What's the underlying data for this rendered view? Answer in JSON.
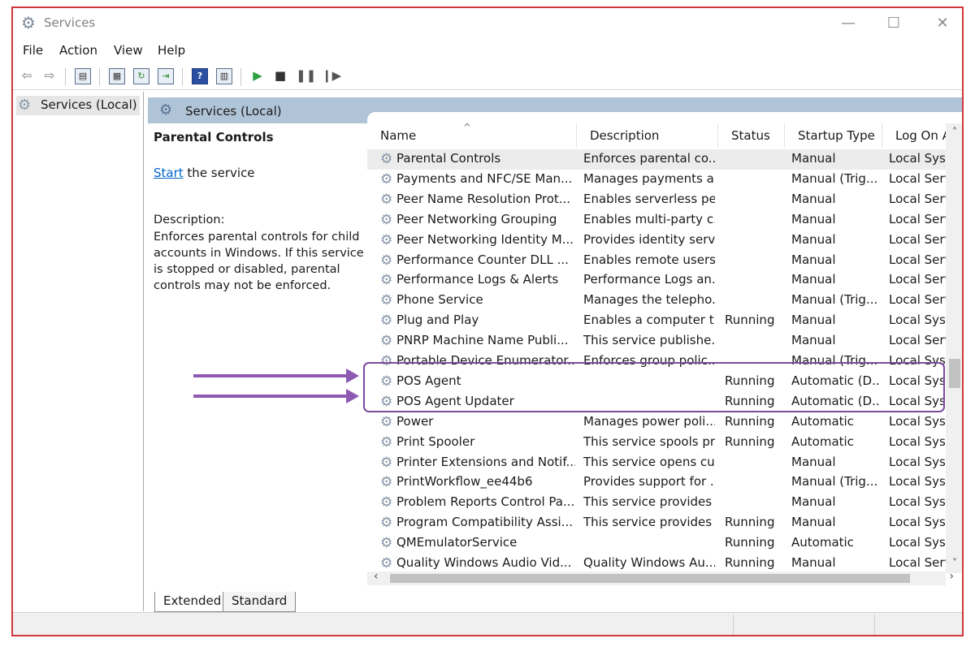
{
  "window": {
    "title": "Services",
    "icon": "gear-icon",
    "controls": [
      "—",
      "☐",
      "✕"
    ]
  },
  "menu": [
    "File",
    "Action",
    "View",
    "Help"
  ],
  "toolbar": {
    "icons": [
      "back-arrow-icon",
      "forward-arrow-icon",
      "show-console-tree-icon",
      "properties-icon",
      "refresh-icon",
      "export-list-icon",
      "help-icon",
      "show-hide-action-pane-icon",
      "start-service-icon",
      "stop-service-icon",
      "pause-service-icon",
      "resume-service-icon"
    ]
  },
  "tree": {
    "item": "Services (Local)"
  },
  "pane": {
    "title": "Services (Local)"
  },
  "description_panel": {
    "title": "Parental Controls",
    "start_link": "Start",
    "start_suffix": " the service",
    "label": "Description:",
    "body": "Enforces parental controls for child accounts in Windows. If this service is stopped or disabled, parental controls may not be enforced."
  },
  "columns": [
    "Name",
    "Description",
    "Status",
    "Startup Type",
    "Log On As"
  ],
  "rows": [
    {
      "name": "Parental Controls",
      "desc": "Enforces parental co...",
      "status": "",
      "startup": "Manual",
      "logon": "Local Syste...",
      "selected": true
    },
    {
      "name": "Payments and NFC/SE Man...",
      "desc": "Manages payments a...",
      "status": "",
      "startup": "Manual (Trig...",
      "logon": "Local Service"
    },
    {
      "name": "Peer Name Resolution Prot...",
      "desc": "Enables serverless pe...",
      "status": "",
      "startup": "Manual",
      "logon": "Local Service"
    },
    {
      "name": "Peer Networking Grouping",
      "desc": "Enables multi-party c...",
      "status": "",
      "startup": "Manual",
      "logon": "Local Service"
    },
    {
      "name": "Peer Networking Identity M...",
      "desc": "Provides identity serv...",
      "status": "",
      "startup": "Manual",
      "logon": "Local Service"
    },
    {
      "name": "Performance Counter DLL ...",
      "desc": "Enables remote users...",
      "status": "",
      "startup": "Manual",
      "logon": "Local Service"
    },
    {
      "name": "Performance Logs & Alerts",
      "desc": "Performance Logs an...",
      "status": "",
      "startup": "Manual",
      "logon": "Local Service"
    },
    {
      "name": "Phone Service",
      "desc": "Manages the telepho...",
      "status": "",
      "startup": "Manual (Trig...",
      "logon": "Local Service"
    },
    {
      "name": "Plug and Play",
      "desc": "Enables a computer t...",
      "status": "Running",
      "startup": "Manual",
      "logon": "Local Syste..."
    },
    {
      "name": "PNRP Machine Name Publi...",
      "desc": "This service publishe...",
      "status": "",
      "startup": "Manual",
      "logon": "Local Service"
    },
    {
      "name": "Portable Device Enumerator...",
      "desc": "Enforces group polic...",
      "status": "",
      "startup": "Manual (Trig...",
      "logon": "Local Syste..."
    },
    {
      "name": "POS Agent",
      "desc": "",
      "status": "Running",
      "startup": "Automatic (D...",
      "logon": "Local Syste..."
    },
    {
      "name": "POS Agent Updater",
      "desc": "",
      "status": "Running",
      "startup": "Automatic (D...",
      "logon": "Local Syste..."
    },
    {
      "name": "Power",
      "desc": "Manages power poli...",
      "status": "Running",
      "startup": "Automatic",
      "logon": "Local Syste..."
    },
    {
      "name": "Print Spooler",
      "desc": "This service spools pr...",
      "status": "Running",
      "startup": "Automatic",
      "logon": "Local Syste..."
    },
    {
      "name": "Printer Extensions and Notif...",
      "desc": "This service opens cu...",
      "status": "",
      "startup": "Manual",
      "logon": "Local Syste..."
    },
    {
      "name": "PrintWorkflow_ee44b6",
      "desc": "Provides support for ...",
      "status": "",
      "startup": "Manual (Trig...",
      "logon": "Local Syste..."
    },
    {
      "name": "Problem Reports Control Pa...",
      "desc": "This service provides ...",
      "status": "",
      "startup": "Manual",
      "logon": "Local Syste..."
    },
    {
      "name": "Program Compatibility Assi...",
      "desc": "This service provides ...",
      "status": "Running",
      "startup": "Manual",
      "logon": "Local Syste..."
    },
    {
      "name": "QMEmulatorService",
      "desc": "",
      "status": "Running",
      "startup": "Automatic",
      "logon": "Local Syste..."
    },
    {
      "name": "Quality Windows Audio Vid...",
      "desc": "Quality Windows Au...",
      "status": "Running",
      "startup": "Manual",
      "logon": "Local Service"
    }
  ],
  "tabs": [
    "Extended",
    "Standard"
  ],
  "colors": {
    "annotation": "#8e59b1",
    "window_border": "#d0373b",
    "pane_header": "#b0c4d8"
  }
}
